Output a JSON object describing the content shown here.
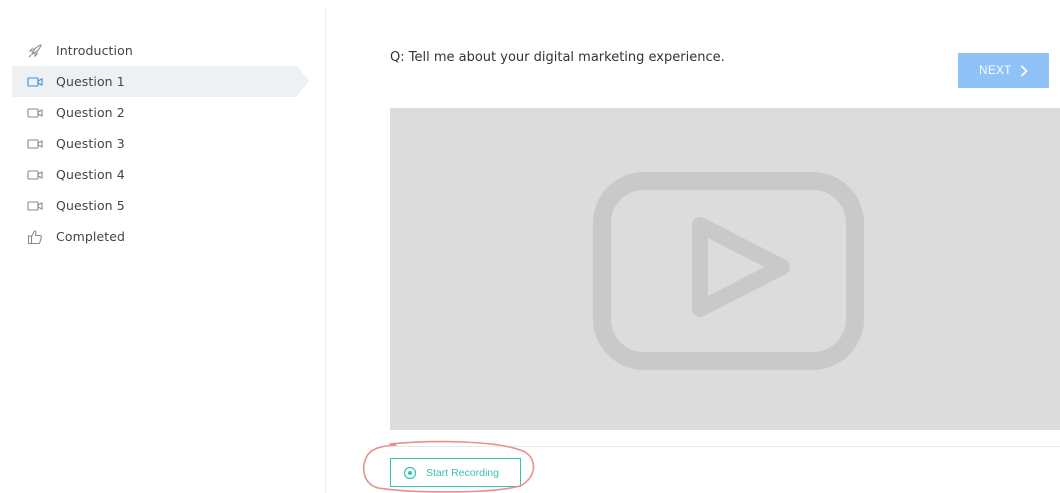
{
  "sidebar": {
    "items": [
      {
        "label": "Introduction",
        "icon": "rocket-icon",
        "active": false
      },
      {
        "label": "Question 1",
        "icon": "video-camera-icon",
        "active": true
      },
      {
        "label": "Question 2",
        "icon": "video-camera-icon",
        "active": false
      },
      {
        "label": "Question 3",
        "icon": "video-camera-icon",
        "active": false
      },
      {
        "label": "Question 4",
        "icon": "video-camera-icon",
        "active": false
      },
      {
        "label": "Question 5",
        "icon": "video-camera-icon",
        "active": false
      },
      {
        "label": "Completed",
        "icon": "thumbs-up-icon",
        "active": false
      }
    ]
  },
  "main": {
    "question": "Q: Tell me about your digital marketing experience.",
    "next_label": "NEXT",
    "record_label": "Start Recording"
  },
  "colors": {
    "accent_teal": "#36c2b1",
    "next_button": "#8fc3f7",
    "active_item_bg": "#eef1f4",
    "video_placeholder": "#dcdcdc",
    "annotation": "#e8908a"
  }
}
